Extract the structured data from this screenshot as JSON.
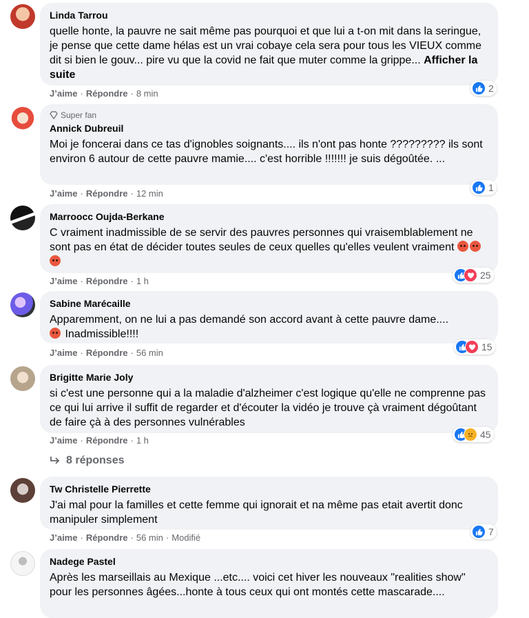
{
  "comments": [
    {
      "author": "Linda Tarrou",
      "badge": "",
      "text": "quelle honte, la pauvre ne sait même pas pourquoi et que lui a t-on mit dans la seringue, je pense que cette dame hélas est un vrai cobaye cela sera pour tous les VIEUX comme dit si bien le gouv... pire vu que la covid ne fait que muter comme la grippe...",
      "more": "Afficher la suite",
      "like": "J’aime",
      "reply": "Répondre",
      "time": "8 min",
      "count": "2",
      "avatar_color": "#c0392b"
    },
    {
      "author": "Annick Dubreuil",
      "badge": "Super fan",
      "text": "Moi je foncerai dans ce tas d'ignobles soignants.... ils n'ont pas honte ????????? ils sont environ 6 autour de cette pauvre mamie.... c'est horrible !!!!!!! je suis dégoûtée. ...",
      "like": "J’aime",
      "reply": "Répondre",
      "time": "12 min",
      "count": "1",
      "avatar_color": "#d35400"
    },
    {
      "author": "Marroocc Oujda-Berkane",
      "badge": "",
      "text": "C vraiment inadmissible de se servir des pauvres personnes qui vraisemblablement ne sont pas en état de décider toutes seules de ceux quelles qu'elles veulent vraiment",
      "like": "J’aime",
      "reply": "Répondre",
      "time": "1 h",
      "count": "25",
      "avatar_color": "#2c2c2c"
    },
    {
      "author": "Sabine Marécaille",
      "badge": "",
      "text_a": "Apparemment, on ne lui a pas demandé son accord avant à cette pauvre dame....",
      "text_b": "Inadmissible!!!!",
      "like": "J’aime",
      "reply": "Répondre",
      "time": "56 min",
      "count": "15",
      "avatar_color": "#6c5ce7"
    },
    {
      "author": "Brigitte Marie Joly",
      "badge": "",
      "text": "si c'est une personne qui a la maladie d'alzheimer c'est logique qu'elle ne comprenne pas ce qui lui arrive il suffit de regarder et d'écouter la vidéo je trouve çà vraiment dégoûtant de faire çà à des personnes vulnérables",
      "like": "J’aime",
      "reply": "Répondre",
      "time": "1 h",
      "count": "45",
      "avatar_color": "#b7a48c"
    },
    {
      "author": "Tw Christelle Pierrette",
      "badge": "",
      "text": "J'ai mal pour la familles et cette femme qui ignorait et na même pas etait avertit donc manipuler simplement",
      "like": "J’aime",
      "reply": "Répondre",
      "time": "56 min",
      "edited": "Modifié",
      "count": "7",
      "avatar_color": "#5d4037"
    },
    {
      "author": "Nadege Pastel",
      "badge": "",
      "text": "Après les marseillais au Mexique ...etc.... voici cet hiver les nouveaux \"realities show\" pour les personnes âgées...honte à tous ceux qui ont montés cette mascarade....",
      "avatar_color": "#dcdcdc"
    }
  ],
  "replies_label": "8 réponses"
}
